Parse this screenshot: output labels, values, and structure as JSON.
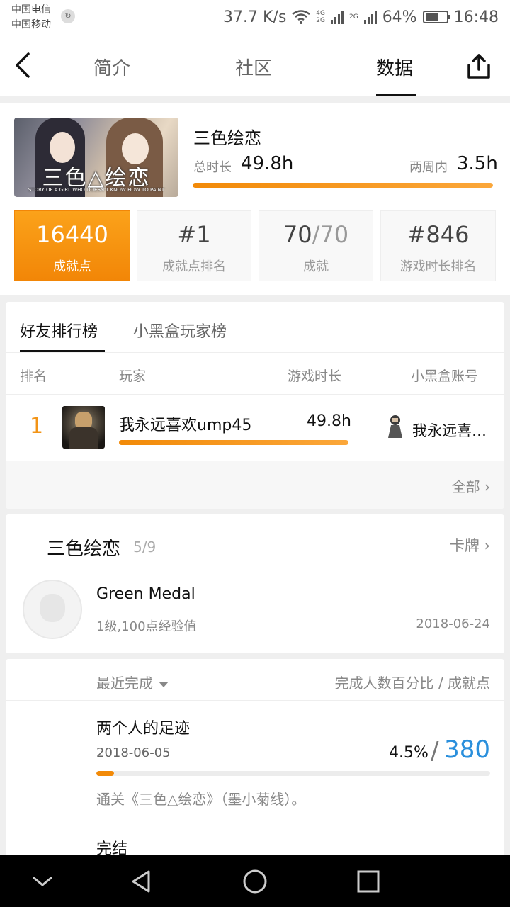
{
  "status_bar": {
    "carrier1": "中国电信",
    "carrier2": "中国移动",
    "speed": "37.7 K/s",
    "net1": "4G",
    "net1b": "2G",
    "net2": "2G",
    "battery": "64%",
    "battery_level": 0.64,
    "time": "16:48"
  },
  "header": {
    "tabs": [
      "简介",
      "社区",
      "数据"
    ],
    "active_tab": "数据"
  },
  "game": {
    "title": "三色绘恋",
    "cover_title": "三色△绘恋",
    "cover_sub": "STORY OF A GIRL WHO DOESN'T KNOW HOW TO PAINT",
    "total_label": "总时长",
    "total_value": "49.8h",
    "twoweek_label": "两周内",
    "twoweek_value": "3.5h",
    "progress": 1.0
  },
  "stats": [
    {
      "value": "16440",
      "label": "成就点"
    },
    {
      "value": "#1",
      "label": "成就点排名"
    },
    {
      "value_a": "70",
      "value_b": "/70",
      "label": "成就"
    },
    {
      "value": "#846",
      "label": "游戏时长排名"
    }
  ],
  "ranking": {
    "tabs": [
      "好友排行榜",
      "小黑盒玩家榜"
    ],
    "columns": [
      "排名",
      "玩家",
      "游戏时长",
      "小黑盒账号"
    ],
    "rows": [
      {
        "rank": "1",
        "player": "我永远喜欢ump45",
        "time": "49.8h",
        "progress": 1.0,
        "account": "我永远喜…"
      }
    ],
    "all_link": "全部 ›"
  },
  "achievements_card": {
    "title": "三色绘恋",
    "count": "5/9",
    "link": "卡牌 ›",
    "item": {
      "name": "Green Medal",
      "desc": "1级,100点经验值",
      "date": "2018-06-24"
    }
  },
  "recent": {
    "sort_label": "最近完成",
    "right_label": "完成人数百分比 / 成就点",
    "items": [
      {
        "name": "两个人的足迹",
        "date": "2018-06-05",
        "percent": "4.5%",
        "slash": "/",
        "points": "380",
        "progress": 0.045,
        "desc": "通关《三色△绘恋》（墨小菊线）。"
      },
      {
        "name": "完结"
      }
    ]
  },
  "colors": {
    "accent": "#f28a08",
    "points_blue": "#2a8fdc"
  }
}
